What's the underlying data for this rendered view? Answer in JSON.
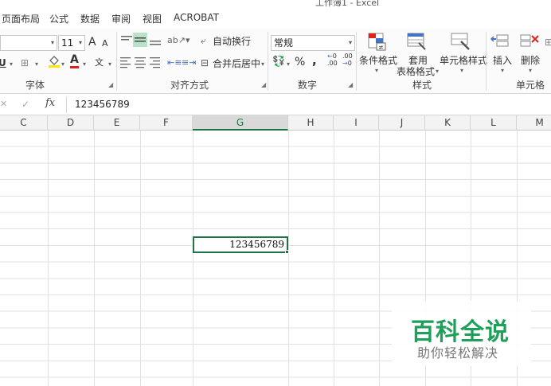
{
  "window": {
    "title": "工作簿1 - Excel"
  },
  "tabs": [
    "页面布局",
    "公式",
    "数据",
    "审阅",
    "视图",
    "ACROBAT"
  ],
  "ribbon": {
    "font": {
      "size": "11",
      "grow_label": "A",
      "shrink_label": "A",
      "underline_label": "U",
      "font_color_label": "A",
      "phonetic_label": "文",
      "group_label": "字体"
    },
    "alignment": {
      "wrap_text": "自动换行",
      "merge_center": "合并后居中",
      "group_label": "对齐方式"
    },
    "number": {
      "format": "常规",
      "percent": "%",
      "comma": ",",
      "inc_decimal": ".00",
      "dec_decimal": ".00",
      "group_label": "数字"
    },
    "styles": {
      "conditional": "条件格式",
      "table_line1": "套用",
      "table_line2": "表格格式",
      "cell_styles": "单元格样式",
      "group_label": "样式"
    },
    "cells": {
      "insert": "插入",
      "delete": "删除",
      "group_label": "单元格"
    }
  },
  "formula_bar": {
    "fx": "fx",
    "cancel": "✕",
    "enter": "✓",
    "value": "123456789"
  },
  "grid": {
    "columns": [
      "C",
      "D",
      "E",
      "F",
      "G",
      "H",
      "I",
      "J",
      "K",
      "L",
      "M"
    ],
    "selected_column": "G",
    "active_cell_value": "123456789"
  },
  "watermark": {
    "main": "百科全说",
    "sub": "助你轻松解决"
  },
  "colors": {
    "accent": "#217346",
    "watermark": "#1fa05a"
  }
}
